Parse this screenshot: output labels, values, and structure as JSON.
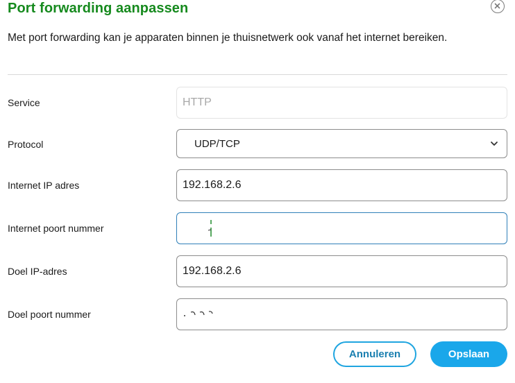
{
  "dialog": {
    "title": "Port forwarding aanpassen",
    "subtitle": "Met port forwarding kan je apparaten binnen je thuisnetwerk ook vanaf het internet bereiken.",
    "close_icon": "close-circle-icon"
  },
  "form": {
    "service": {
      "label": "Service",
      "value": "HTTP",
      "disabled": true
    },
    "protocol": {
      "label": "Protocol",
      "value": "UDP/TCP"
    },
    "internet_ip": {
      "label": "Internet IP adres",
      "value": "192.168.2.6"
    },
    "internet_port": {
      "label": "Internet poort nummer",
      "value": ""
    },
    "target_ip": {
      "label": "Doel IP-adres",
      "value": "192.168.2.6"
    },
    "target_port": {
      "label": "Doel poort nummer",
      "value": ""
    }
  },
  "actions": {
    "cancel_label": "Annuleren",
    "save_label": "Opslaan"
  },
  "colors": {
    "title": "#168a1e",
    "primary": "#1aa7ea",
    "focus_border": "#2f7fb8"
  }
}
